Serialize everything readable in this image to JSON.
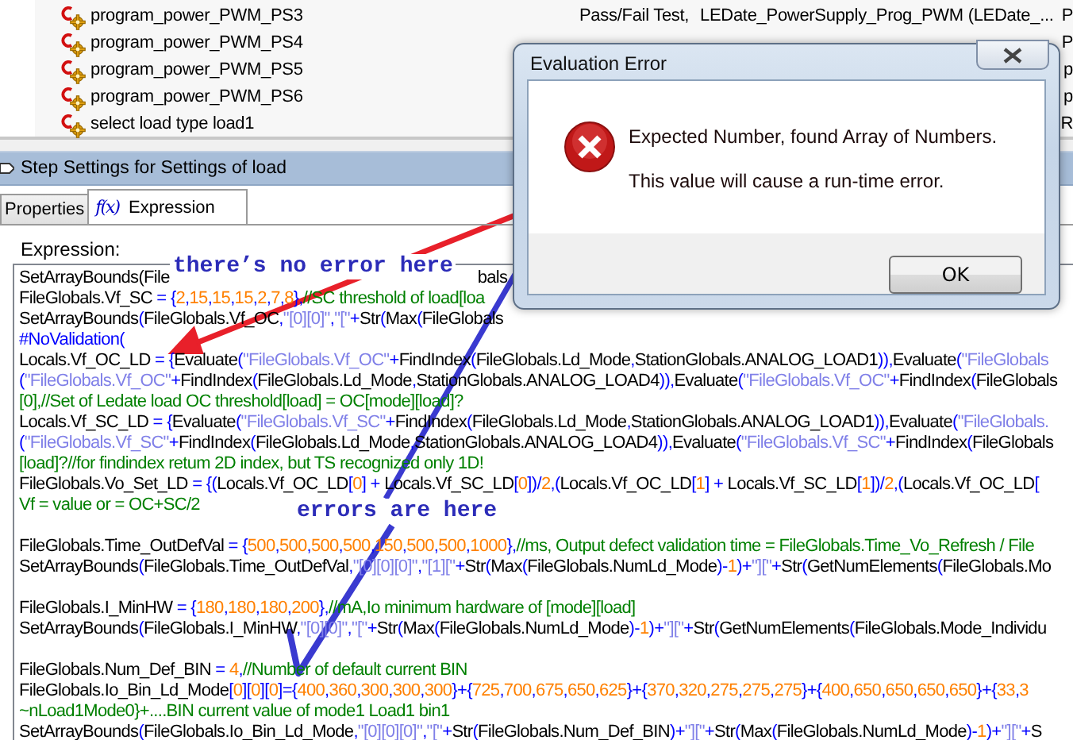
{
  "tree": {
    "rows": [
      {
        "name": "program_power_PWM_PS3",
        "column_2": "Pass/Fail Test,",
        "column_3": "LEDate_PowerSupply_Prog_PWM (LEDate_...",
        "column_4": "P"
      },
      {
        "name": "program_power_PWM_PS4",
        "column_4": "P"
      },
      {
        "name": "program_power_PWM_PS5",
        "column_4": "p"
      },
      {
        "name": "program_power_PWM_PS6",
        "column_4": "p"
      },
      {
        "name": "select load type load1",
        "column_4": "R"
      }
    ]
  },
  "panel": {
    "title": "Step Settings for Settings of load"
  },
  "tabs": [
    {
      "label": "Properties",
      "selected": false
    },
    {
      "label": "Expression",
      "icon": "f(x)",
      "selected": true
    }
  ],
  "expression": {
    "label": "Expression:",
    "lines": [
      {
        "kind": "split",
        "parts": [
          "SetArrayBounds(File",
          "bals"
        ]
      },
      {
        "kind": "code",
        "text": "FileGlobals.Vf_SC = {2,15,15,15,2,7,8},//SC threshold of load[loa"
      },
      {
        "kind": "code",
        "text": "SetArrayBounds(FileGlobals.Vf_OC,\"[0][0]\",\"[\"+Str(Max(FileGlobals"
      },
      {
        "kind": "directive",
        "text": "#NoValidation("
      },
      {
        "kind": "code",
        "text": "Locals.Vf_OC_LD = {Evaluate(\"FileGlobals.Vf_OC\"+FindIndex(FileGlobals.Ld_Mode,StationGlobals.ANALOG_LOAD1)),Evaluate(\"FileGlobals"
      },
      {
        "kind": "code",
        "text": "(\"FileGlobals.Vf_OC\"+FindIndex(FileGlobals.Ld_Mode,StationGlobals.ANALOG_LOAD4)),Evaluate(\"FileGlobals.Vf_OC\"+FindIndex(FileGlobals"
      },
      {
        "kind": "comment",
        "text": "[0],//Set of Ledate load OC threshold[load] = OC[mode][load]?"
      },
      {
        "kind": "code",
        "text": "Locals.Vf_SC_LD = {Evaluate(\"FileGlobals.Vf_SC\"+FindIndex(FileGlobals.Ld_Mode,StationGlobals.ANALOG_LOAD1)),Evaluate(\"FileGlobals."
      },
      {
        "kind": "code",
        "text": "(\"FileGlobals.Vf_SC\"+FindIndex(FileGlobals.Ld_Mode,StationGlobals.ANALOG_LOAD4)),Evaluate(\"FileGlobals.Vf_SC\"+FindIndex(FileGlobals"
      },
      {
        "kind": "comment",
        "text": "[load]?//for findindex retum 2D index, but TS recognized only 1D!"
      },
      {
        "kind": "code",
        "text": "FileGlobals.Vo_Set_LD = {(Locals.Vf_OC_LD[0] + Locals.Vf_SC_LD[0])/2,(Locals.Vf_OC_LD[1] + Locals.Vf_SC_LD[1])/2,(Locals.Vf_OC_LD["
      },
      {
        "kind": "comment",
        "text": "Vf = value or = OC+SC/2"
      },
      {
        "kind": "blank"
      },
      {
        "kind": "code",
        "text": "FileGlobals.Time_OutDefVal = {500,500,500,500,150,500,500,1000},//ms, Output defect validation time = FileGlobals.Time_Vo_Refresh / File"
      },
      {
        "kind": "code",
        "text": "SetArrayBounds(FileGlobals.Time_OutDefVal,\"[0][0][0]\",\"[1][\"+Str(Max(FileGlobals.NumLd_Mode)-1)+\"][\"+Str(GetNumElements(FileGlobals.Mo"
      },
      {
        "kind": "blank"
      },
      {
        "kind": "code",
        "text": "FileGlobals.I_MinHW = {180,180,180,200},//mA,Io minimum hardware of [mode][load]"
      },
      {
        "kind": "code",
        "text": "SetArrayBounds(FileGlobals.I_MinHW,\"[0][0]\",\"[\"+Str(Max(FileGlobals.NumLd_Mode)-1)+\"][\"+Str(GetNumElements(FileGlobals.Mode_Individu"
      },
      {
        "kind": "blank"
      },
      {
        "kind": "code",
        "text": "FileGlobals.Num_Def_BIN = 4,//Number of default current BIN"
      },
      {
        "kind": "code",
        "text": "FileGlobals.Io_Bin_Ld_Mode[0][0][0]={400,360,300,300,300}+{725,700,675,650,625}+{370,320,275,275,275}+{400,650,650,650,650}+{33,3"
      },
      {
        "kind": "comment",
        "text": "~nLoad1Mode0}+....BIN current value of mode1 Load1 bin1"
      },
      {
        "kind": "code",
        "text": "SetArrayBounds(FileGlobals.Io_Bin_Ld_Mode,\"[0][0][0]\",\"[\"+Str(FileGlobals.Num_Def_BIN)+\"][\"+Str(Max(FileGlobals.NumLd_Mode)-1)+\"][\"+S"
      }
    ]
  },
  "dialog": {
    "title": "Evaluation Error",
    "messages": [
      "Expected Number, found Array of Numbers.",
      "This value will cause a run-time error."
    ],
    "buttons": [
      "OK"
    ]
  },
  "annotations": [
    {
      "text": "there’s no error here",
      "color": "#2c2cb8"
    },
    {
      "text": "errors are here",
      "color": "#2c2cb8"
    }
  ],
  "arrows": [
    {
      "kind": "arrow",
      "color": "#e8202a"
    },
    {
      "kind": "check",
      "color": "#3a3ad0"
    }
  ]
}
